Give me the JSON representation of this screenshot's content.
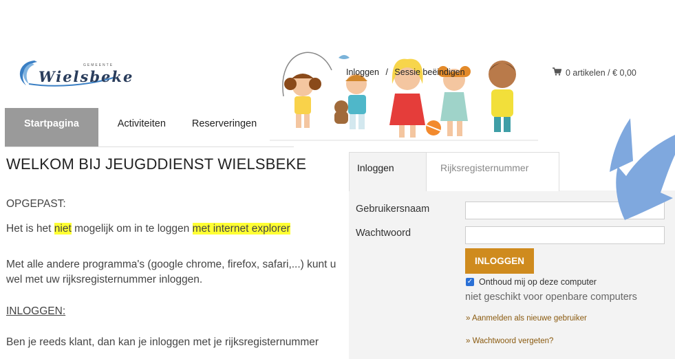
{
  "logo": {
    "text": "Wielsbeke",
    "subtext": "GEMEENTE"
  },
  "header": {
    "login_link": "Inloggen",
    "separator": "/",
    "logout_link": "Sessie beëindigen",
    "cart_text": "0 artikelen / € 0,00"
  },
  "nav": {
    "items": [
      {
        "label": "Startpagina"
      },
      {
        "label": "Activiteiten"
      },
      {
        "label": "Reserveringen"
      }
    ]
  },
  "main": {
    "title": "WELKOM BIJ JEUGDDIENST WIELSBEKE",
    "opgepast": "OPGEPAST:",
    "ie_part1": "Het is het ",
    "ie_highlight1": "niet",
    "ie_part2": " mogelijk om in te loggen ",
    "ie_highlight2": "met internet explorer",
    "browsers": "Met alle andere programma's (google chrome, firefox, safari,...) kunt u wel met uw rijksregisternummer inloggen.",
    "inloggen_heading": "INLOGGEN:",
    "klant_text": "Ben je reeds klant, dan kan je inloggen met je rijksregisternummer"
  },
  "login": {
    "tabs": [
      {
        "label": "Inloggen"
      },
      {
        "label": "Rijksregisternummer"
      }
    ],
    "username_label": "Gebruikersnaam",
    "password_label": "Wachtwoord",
    "username_value": "",
    "password_value": "",
    "button_label": "INLOGGEN",
    "remember_label": "Onthoud mij op deze computer",
    "not_public": "niet geschikt voor openbare computers",
    "register_link": "» Aanmelden als nieuwe gebruiker",
    "forgot_link": "» Wachtwoord vergeten?"
  },
  "colors": {
    "accent_button": "#cf8b1e",
    "nav_active": "#9a9a9a",
    "highlight": "#ffff33",
    "arrow": "#7fa8de"
  }
}
